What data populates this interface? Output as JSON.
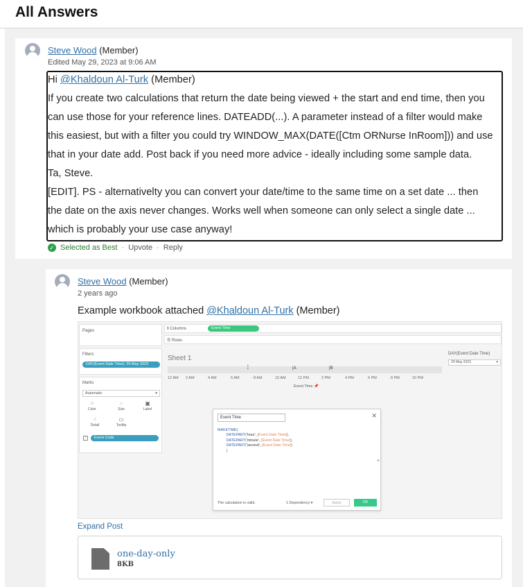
{
  "page_title": "All Answers",
  "answer1": {
    "author": "Steve Wood",
    "role": "(Member)",
    "edited": "Edited May 29, 2023 at 9:06 AM",
    "body": {
      "greeting_prefix": "Hi ",
      "mention": "@Khaldoun Al-Turk",
      "mention_role": " (Member)",
      "lines": [
        "If you create two calculations that return the date being viewed + the start and end time, then you",
        "can use those for your reference lines. DATEADD(...). A parameter instead of a filter would make",
        "this easiest, but with a filter you could try WINDOW_MAX(DATE([Ctm ORNurse InRoom])) and use",
        "that in your date add. Post back if you need more advice - ideally including some sample data.",
        "Ta, Steve.",
        "[EDIT]. PS - alternativelty you can convert your date/time to the same time on a set date ... then",
        "the date on the axis never changes. Works well when someone can only select a single date ...",
        "which is probably your use case anyway!"
      ]
    },
    "actions": {
      "best": "Selected as Best",
      "upvote": "Upvote",
      "reply": "Reply"
    }
  },
  "answer2": {
    "author": "Steve Wood",
    "role": "(Member)",
    "time": "2 years ago",
    "text_prefix": "Example workbook attached ",
    "mention": "@Khaldoun Al-Turk",
    "mention_role": " (Member)",
    "expand": "Expand Post",
    "attachment": {
      "name": "one-day-only",
      "size": "8KB"
    }
  },
  "screenshot": {
    "pages": "Pages",
    "columns_label": "Columns",
    "columns_pill": "Event Time",
    "rows_label": "Rows",
    "filters": "Filters",
    "filter_pill": "DAY(Event Date Time): 29 May 2023",
    "marks": "Marks",
    "marks_type": "Automatic",
    "mark_buttons": [
      "Color",
      "Size",
      "Label",
      "Detail",
      "Tooltip"
    ],
    "marks_pill": "Event Code",
    "sheet": "Sheet 1",
    "axis_ticks": [
      "12 AM",
      "2 AM",
      "4 AM",
      "6 AM",
      "8 AM",
      "10 AM",
      "12 PM",
      "2 PM",
      "4 PM",
      "6 PM",
      "8 PM",
      "10 PM"
    ],
    "axis_marker_a": "A",
    "axis_marker_b": "B",
    "axis_title": "Event Time",
    "right_filter_title": "DAY(Event Date Time)",
    "right_filter_value": "29 May 2023",
    "calc": {
      "name": "Event Time",
      "code_fn": "MAKETIME(",
      "code_lines": [
        {
          "fn": "DATEPART(",
          "arg": "'hour'",
          "field": "[Event Date Time]",
          "end": "),"
        },
        {
          "fn": "DATEPART(",
          "arg": "'minute'",
          "field": "[Event Date Time]",
          "end": "),"
        },
        {
          "fn": "DATEPART(",
          "arg": "'second'",
          "field": "[Event Date Time]",
          "end": ")"
        }
      ],
      "code_close": ")",
      "valid": "The calculation is valid.",
      "dependency": "1 Dependency ▾",
      "apply": "Apply",
      "ok": "OK"
    }
  },
  "colors": {
    "link": "#2f6fa7",
    "best_green": "#2e9e4a",
    "pill_teal": "#3a9fbe",
    "pill_green": "#3cc77f"
  }
}
